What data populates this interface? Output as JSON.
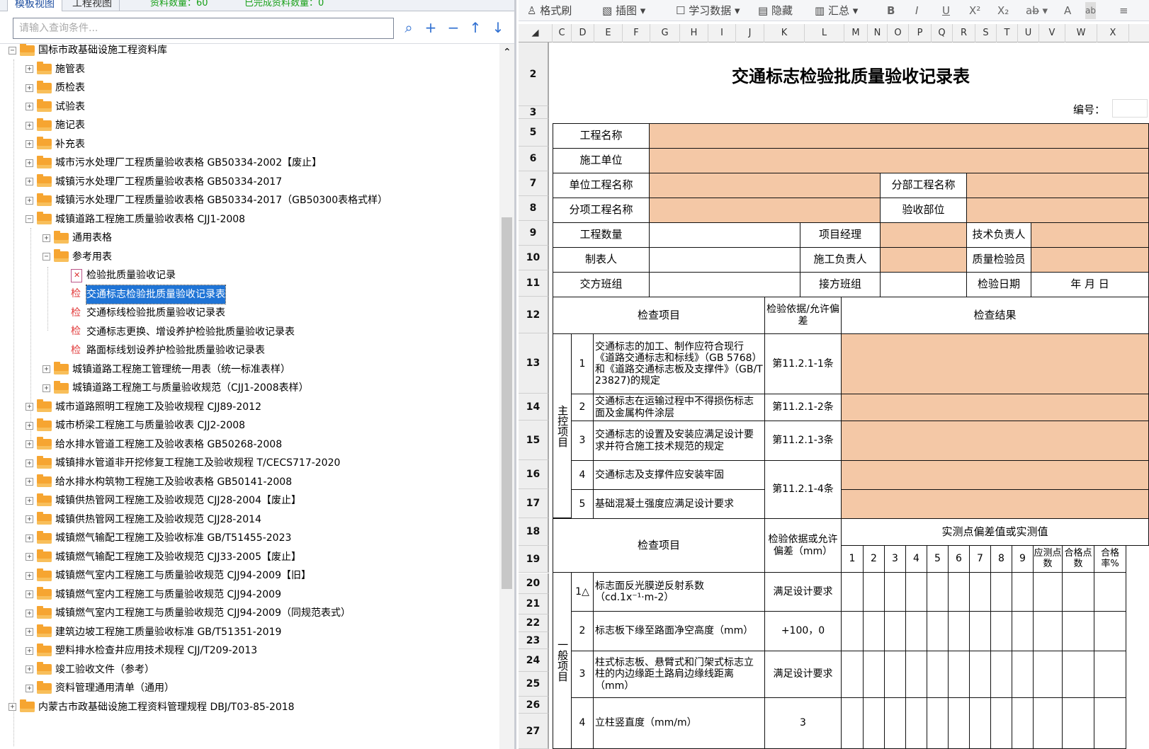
{
  "left_panel": {
    "tabs": [
      "模板视图",
      "工程视图"
    ],
    "stats": {
      "data_count": "资料数量：60",
      "completed_count": "已完成资料数量：0"
    },
    "search": {
      "placeholder": "请输入查询条件..."
    },
    "tree": [
      {
        "label": "国标市政基础设施工程资料库",
        "type": "folder",
        "expanded": true
      },
      {
        "label": "施管表",
        "type": "folder"
      },
      {
        "label": "质检表",
        "type": "folder"
      },
      {
        "label": "试验表",
        "type": "folder"
      },
      {
        "label": "施记表",
        "type": "folder"
      },
      {
        "label": "补充表",
        "type": "folder"
      },
      {
        "label": "城市污水处理厂工程质量验收表格 GB50334-2002【废止】",
        "type": "folder"
      },
      {
        "label": "城镇污水处理厂工程质量验收表格 GB50334-2017",
        "type": "folder"
      },
      {
        "label": "城镇污水处理厂工程质量验收表格 GB50334-2017（GB50300表格式样）",
        "type": "folder"
      },
      {
        "label": "城镇道路工程施工质量验收表格 CJJ1-2008",
        "type": "folder",
        "expanded": true
      },
      {
        "label": "通用表格",
        "type": "folder"
      },
      {
        "label": "参考用表",
        "type": "folder",
        "expanded": true
      },
      {
        "label": "检验批质量验收记录",
        "type": "doc"
      },
      {
        "label": "交通标志检验批质量验收记录表",
        "type": "jian",
        "selected": true
      },
      {
        "label": "交通标线检验批质量验收记录表",
        "type": "jian"
      },
      {
        "label": "交通标志更换、增设养护检验批质量验收记录表",
        "type": "jian"
      },
      {
        "label": "路面标线划设养护检验批质量验收记录表",
        "type": "jian"
      },
      {
        "label": "城镇道路工程施工管理统一用表（统一标准表样）",
        "type": "folder"
      },
      {
        "label": "城镇道路工程施工与质量验收规范（CJJ1-2008表样）",
        "type": "folder"
      },
      {
        "label": "城市道路照明工程施工及验收规程 CJJ89-2012",
        "type": "folder"
      },
      {
        "label": "城市桥梁工程施工与质量验收表 CJJ2-2008",
        "type": "folder"
      },
      {
        "label": "给水排水管道工程施工及验收表格 GB50268-2008",
        "type": "folder"
      },
      {
        "label": "城镇排水管道非开挖修复工程施工及验收规程 T/CECS717-2020",
        "type": "folder"
      },
      {
        "label": "给水排水构筑物工程施工及验收表格 GB50141-2008",
        "type": "folder"
      },
      {
        "label": "城镇供热管网工程施工及验收规范 CJJ28-2004【废止】",
        "type": "folder"
      },
      {
        "label": "城镇供热管网工程施工及验收规范 CJJ28-2014",
        "type": "folder"
      },
      {
        "label": "城镇燃气输配工程施工及验收标准 GB/T51455-2023",
        "type": "folder"
      },
      {
        "label": "城镇燃气输配工程施工及验收规范 CJJ33-2005【废止】",
        "type": "folder"
      },
      {
        "label": "城镇燃气室内工程施工与质量验收规范 CJJ94-2009【旧】",
        "type": "folder"
      },
      {
        "label": "城镇燃气室内工程施工与质量验收规范 CJJ94-2009",
        "type": "folder"
      },
      {
        "label": "城镇燃气室内工程施工与质量验收规范 CJJ94-2009（同规范表式）",
        "type": "folder"
      },
      {
        "label": "建筑边坡工程施工质量验收标准 GB/T51351-2019",
        "type": "folder"
      },
      {
        "label": "塑料排水检查井应用技术规程 CJJ/T209-2013",
        "type": "folder"
      },
      {
        "label": "竣工验收文件（参考）",
        "type": "folder"
      },
      {
        "label": "资料管理通用清单（通用）",
        "type": "folder"
      },
      {
        "label": "内蒙古市政基础设施工程资料管理规程 DBJ/T03-85-2018",
        "type": "folder"
      }
    ]
  },
  "right_panel": {
    "toolbar": {
      "format": "格式刷",
      "image": "插图",
      "study": "学习数据",
      "hide": "隐藏",
      "summary": "汇总",
      "bold": "B",
      "italic": "I",
      "underline": "U",
      "superscript": "X²",
      "subscript": "X₂"
    },
    "columns": [
      "C",
      "D",
      "E",
      "F",
      "G",
      "H",
      "I",
      "J",
      "K",
      "L",
      "M",
      "N",
      "O",
      "P",
      "Q",
      "R",
      "S",
      "T",
      "U",
      "V",
      "W",
      "X"
    ],
    "rows": [
      "2",
      "3",
      "5",
      "6",
      "7",
      "8",
      "9",
      "10",
      "11",
      "12",
      "13",
      "14",
      "15",
      "16",
      "17",
      "18",
      "19",
      "20",
      "21",
      "22",
      "23",
      "24",
      "25",
      "26",
      "27"
    ],
    "form": {
      "title": "交通标志检验批质量验收记录表",
      "number_label": "编号：",
      "project_name": "工程名称",
      "construction_unit": "施工单位",
      "unit_project": "单位工程名称",
      "sub_project": "分部工程名称",
      "item_project": "分项工程名称",
      "acceptance_part": "验收部位",
      "quantity": "工程数量",
      "project_manager": "项目经理",
      "tech_lead": "技术负责人",
      "preparer": "制表人",
      "construction_lead": "施工负责人",
      "quality_inspector": "质量检验员",
      "handover_team": "交方班组",
      "receiving_team": "接方班组",
      "inspection_date": "检验日期",
      "date_units": "年  月  日",
      "check_item": "检查项目",
      "basis": "检验依据/允许偏差",
      "result": "检查结果",
      "main_control": "主控项目",
      "general": "一般项目",
      "main_items": [
        {
          "no": "1",
          "text": "交通标志的加工、制作应符合现行《道路交通标志和标线》（GB 5768）和《道路交通标志板及支撑件》（GB/T 23827)的规定",
          "basis": "第11.2.1-1条"
        },
        {
          "no": "2",
          "text": "交通标志在运输过程中不得损伤标志面及金属构件涂层",
          "basis": "第11.2.1-2条"
        },
        {
          "no": "3",
          "text": "交通标志的设置及安装应满足设计要求并符合施工技术规范的规定",
          "basis": "第11.2.1-3条"
        },
        {
          "no": "4",
          "text": "交通标志及支撑件应安装牢固",
          "basis": "第11.2.1-4条"
        },
        {
          "no": "5",
          "text": "基础混凝土强度应满足设计要求"
        }
      ],
      "measure_header": "实测点偏差值或实测值",
      "basis2": "检验依据或允许偏差（mm）",
      "points": [
        "1",
        "2",
        "3",
        "4",
        "5",
        "6",
        "7",
        "8",
        "9"
      ],
      "should_count": "应测点数",
      "pass_count": "合格点数",
      "pass_rate": "合格率%",
      "general_items": [
        {
          "no": "1△",
          "text": "标志面反光膜逆反射系数（cd.1x⁻¹·m-2）",
          "basis": "满足设计要求"
        },
        {
          "no": "2",
          "text": "标志板下缘至路面净空高度（mm）",
          "basis": "+100，0"
        },
        {
          "no": "3",
          "text": "柱式标志板、悬臂式和门架式标志立柱的内边缘距土路肩边缘线距离（mm）",
          "basis": "满足设计要求"
        },
        {
          "no": "4",
          "text": "立柱竖直度（mm/m）",
          "basis": "3"
        }
      ]
    }
  }
}
